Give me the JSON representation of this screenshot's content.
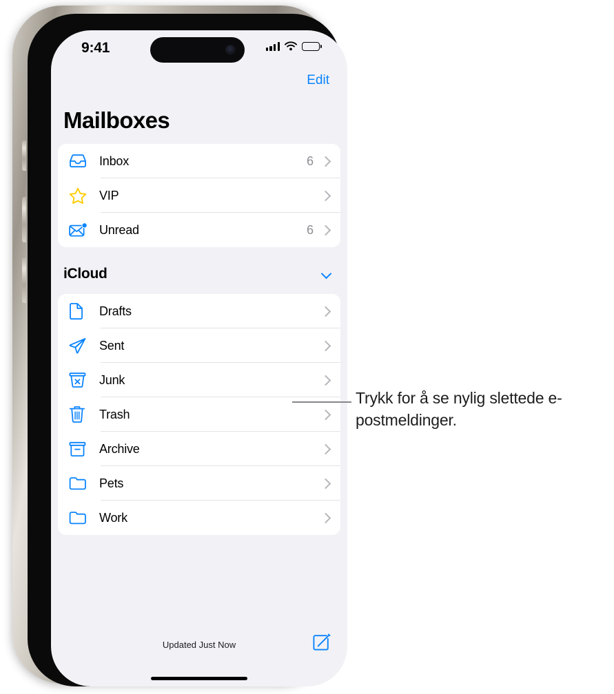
{
  "status_bar": {
    "time": "9:41",
    "signal_icon": "cellular-signal-icon",
    "wifi_icon": "wifi-icon",
    "battery_icon": "battery-icon"
  },
  "nav": {
    "edit_label": "Edit",
    "title": "Mailboxes"
  },
  "favorites": {
    "rows": [
      {
        "label": "Inbox",
        "count": "6",
        "icon": "inbox-tray-icon"
      },
      {
        "label": "VIP",
        "count": "",
        "icon": "star-icon"
      },
      {
        "label": "Unread",
        "count": "6",
        "icon": "unread-envelope-icon"
      }
    ]
  },
  "icloud": {
    "header": "iCloud",
    "collapse_icon": "chevron-down-icon",
    "rows": [
      {
        "label": "Drafts",
        "count": "",
        "icon": "document-icon"
      },
      {
        "label": "Sent",
        "count": "",
        "icon": "paper-plane-icon"
      },
      {
        "label": "Junk",
        "count": "",
        "icon": "junk-bin-icon"
      },
      {
        "label": "Trash",
        "count": "",
        "icon": "trash-icon"
      },
      {
        "label": "Archive",
        "count": "",
        "icon": "archive-box-icon"
      },
      {
        "label": "Pets",
        "count": "",
        "icon": "folder-icon"
      },
      {
        "label": "Work",
        "count": "",
        "icon": "folder-icon"
      }
    ]
  },
  "toolbar": {
    "status_text": "Updated Just Now",
    "compose_icon": "compose-icon"
  },
  "callout": {
    "text": "Trykk for å se nylig slettede e-postmeldinger."
  },
  "colors": {
    "accent_blue": "#0a84ff",
    "star_yellow": "#ffcc00",
    "screen_bg": "#f2f1f6",
    "card_bg": "#ffffff",
    "secondary_text": "#8e8e93"
  }
}
